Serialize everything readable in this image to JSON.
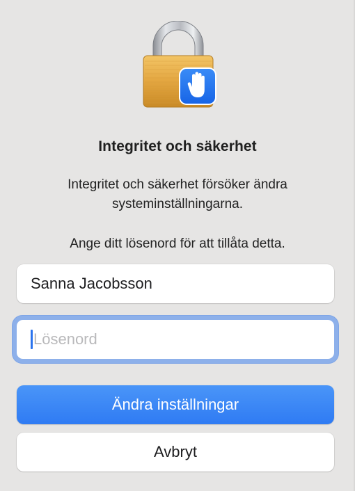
{
  "dialog": {
    "title": "Integritet och säkerhet",
    "message": "Integritet och säkerhet försöker ändra systeminställningarna.",
    "prompt": "Ange ditt lösenord för att tillåta detta.",
    "icon": "padlock-with-hand-icon",
    "username": {
      "value": "Sanna Jacobsson"
    },
    "password": {
      "value": "",
      "placeholder": "Lösenord"
    },
    "buttons": {
      "confirm_label": "Ändra inställningar",
      "cancel_label": "Avbryt"
    }
  },
  "colors": {
    "background": "#e6e5e4",
    "accent": "#2f7bf3",
    "focus_ring": "#8db0ea",
    "lock_gold": "#e8b046",
    "badge_blue": "#1f6ff0"
  }
}
